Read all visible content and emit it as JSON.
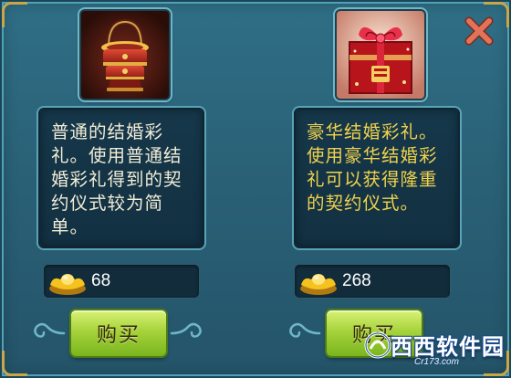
{
  "dialog": {
    "close_icon": "close-x-icon",
    "colors": {
      "panel": "#2a6177",
      "gold_trim": "#c9a64a",
      "close_x": "#e2735a"
    }
  },
  "items": [
    {
      "image": "red-lacquer-gift-basket",
      "description": "普通的结婚彩礼。使用普通结婚彩礼得到的契约仪式较为简单。",
      "description_color": "#f2ecd6",
      "currency_icon": "gold-ingot-icon",
      "price": "68",
      "buy_label": "购买"
    },
    {
      "image": "luxury-gift-box-with-bow",
      "description": "豪华结婚彩礼。使用豪华结婚彩礼可以获得隆重的契约仪式。",
      "description_color": "#f0d24c",
      "currency_icon": "gold-ingot-icon",
      "price": "268",
      "buy_label": "购买"
    }
  ],
  "watermark": {
    "logo": "西西软件园",
    "site": "Cr173.com"
  }
}
